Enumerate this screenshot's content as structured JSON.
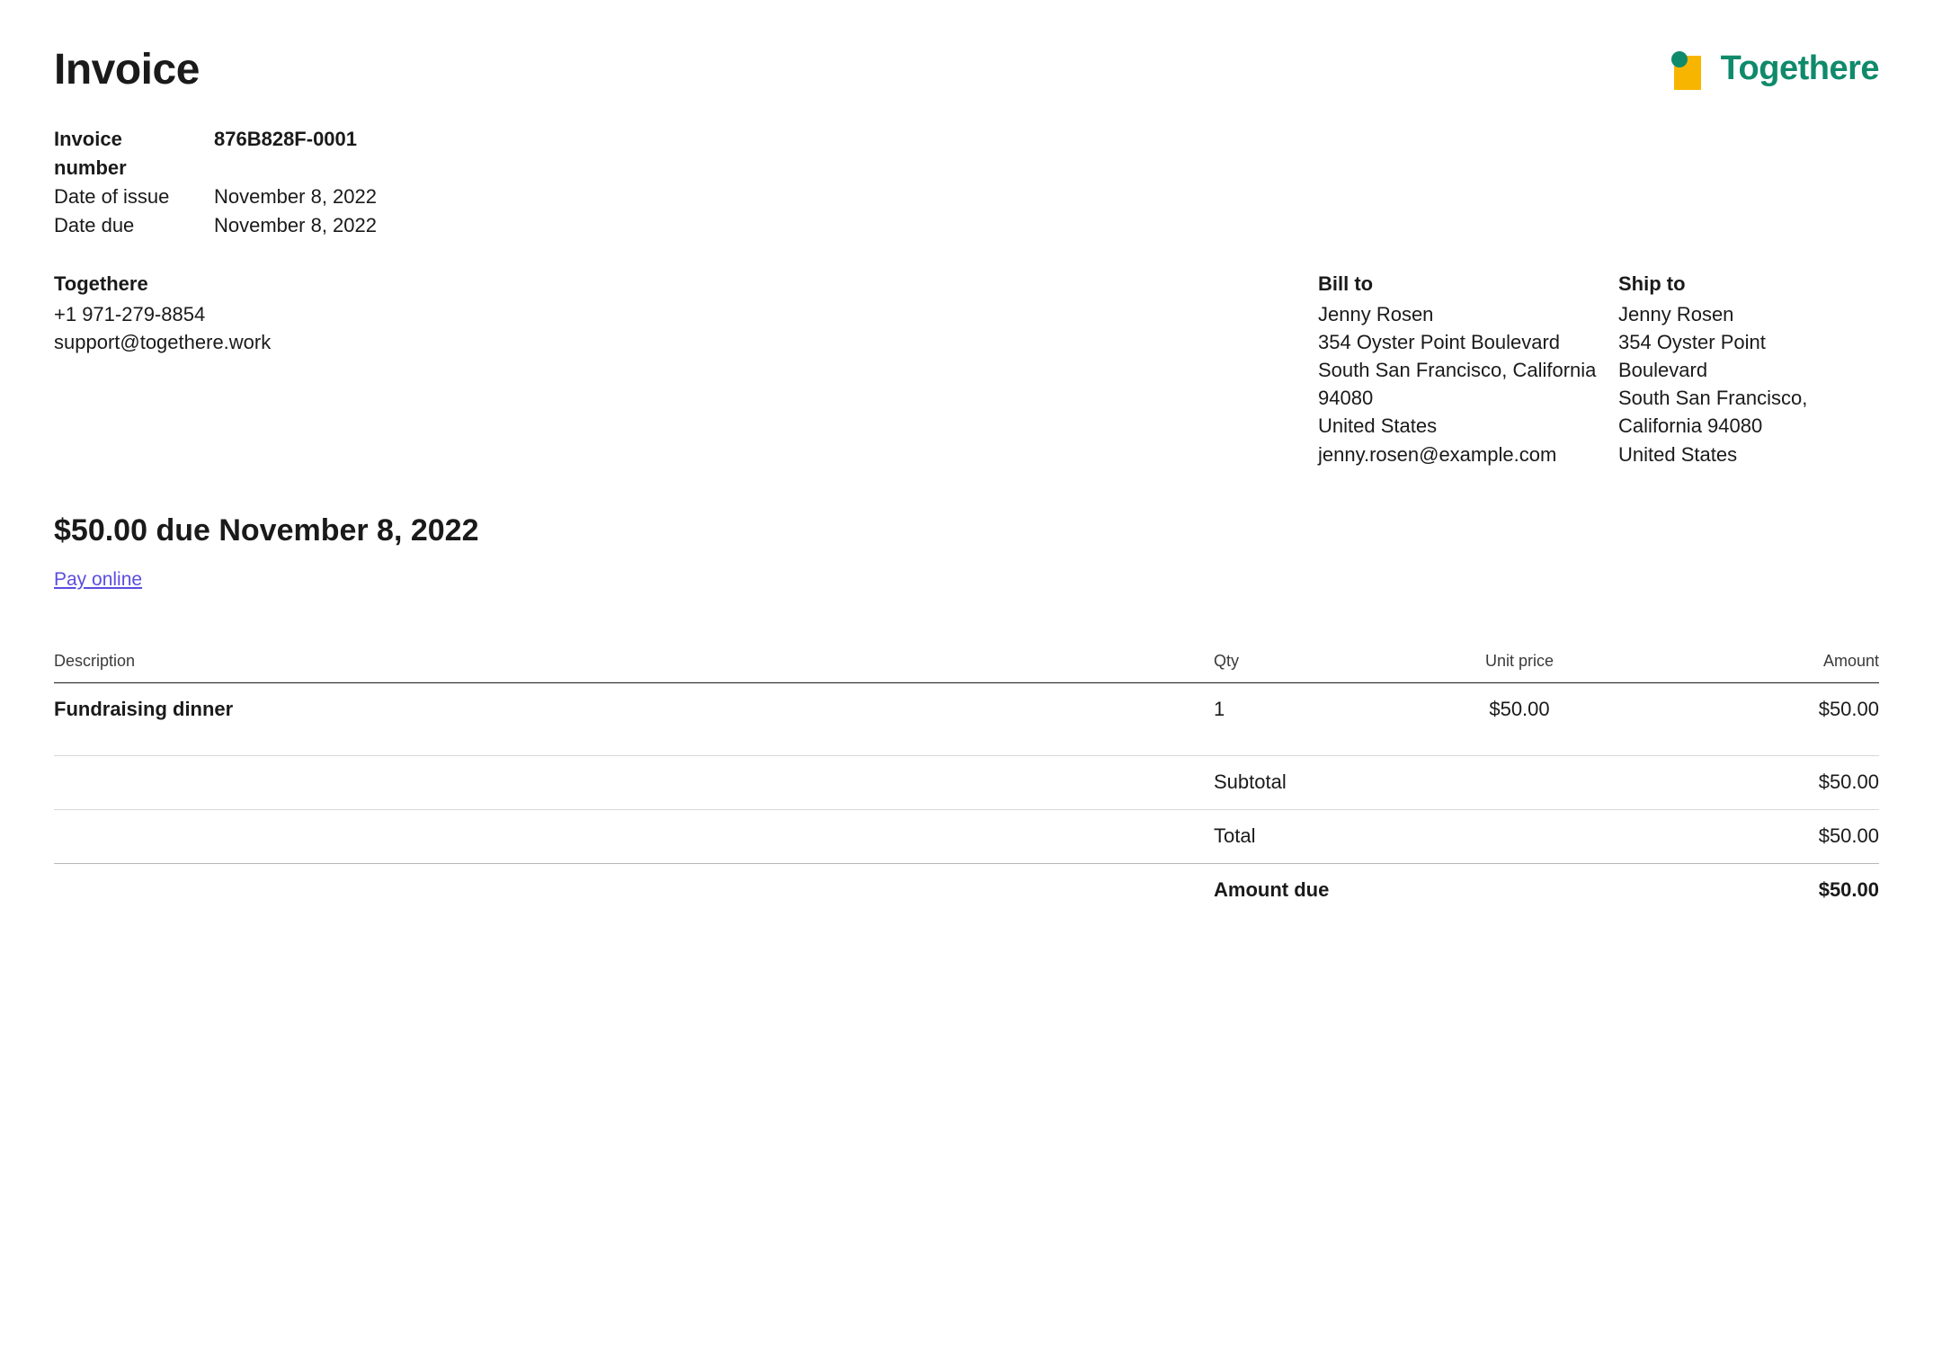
{
  "brand": {
    "name": "Togethere",
    "accent": "#0f8a6b",
    "mark_yellow": "#f7b500",
    "mark_teal": "#0f8a6b"
  },
  "title": "Invoice",
  "meta": {
    "invoice_number_label": "Invoice number",
    "invoice_number": "876B828F-0001",
    "date_of_issue_label": "Date of issue",
    "date_of_issue": "November 8, 2022",
    "date_due_label": "Date due",
    "date_due": "November 8, 2022"
  },
  "from": {
    "name": "Togethere",
    "phone": "+1 971-279-8854",
    "email": "support@togethere.work"
  },
  "bill_to": {
    "heading": "Bill to",
    "name": "Jenny Rosen",
    "street": "354 Oyster Point Boulevard",
    "city_line": "South San Francisco, California 94080",
    "country": "United States",
    "email": "jenny.rosen@example.com"
  },
  "ship_to": {
    "heading": "Ship to",
    "name": "Jenny Rosen",
    "street1": "354 Oyster Point",
    "street2": "Boulevard",
    "city_line1": "South San Francisco,",
    "city_line2": "California 94080",
    "country": "United States"
  },
  "summary": {
    "due_line": "$50.00 due November 8, 2022",
    "pay_link_label": "Pay online"
  },
  "table": {
    "headers": {
      "description": "Description",
      "qty": "Qty",
      "unit_price": "Unit price",
      "amount": "Amount"
    },
    "items": [
      {
        "description": "Fundraising dinner",
        "qty": "1",
        "unit_price": "$50.00",
        "amount": "$50.00"
      }
    ],
    "totals": {
      "subtotal_label": "Subtotal",
      "subtotal": "$50.00",
      "total_label": "Total",
      "total": "$50.00",
      "amount_due_label": "Amount due",
      "amount_due": "$50.00"
    }
  }
}
